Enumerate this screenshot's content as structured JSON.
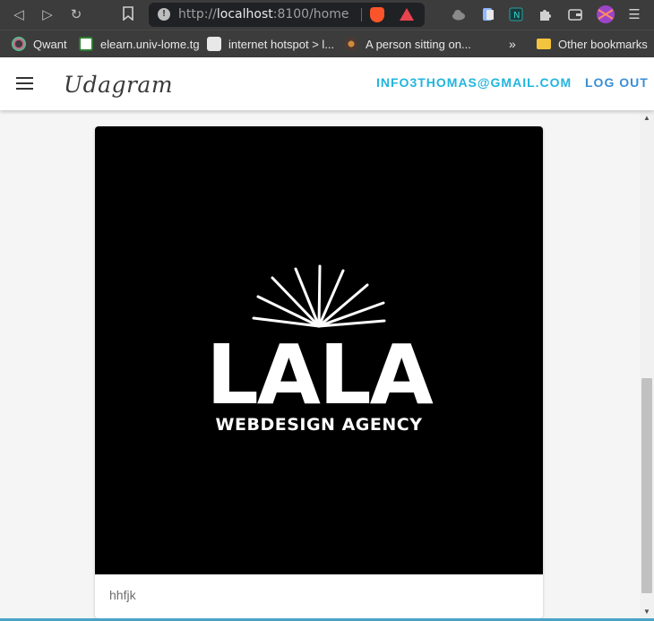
{
  "browser": {
    "url_scheme": "http://",
    "url_host": "localhost",
    "url_rest": ":8100/home",
    "bookmarks": [
      {
        "label": "Qwant",
        "color": "#3ecf8e"
      },
      {
        "label": "elearn.univ-lome.tg",
        "color": "#2e7d32"
      },
      {
        "label": "internet hotspot > l...",
        "color": "#cfcfcf"
      },
      {
        "label": "A person sitting on...",
        "color": "#8d6e63"
      }
    ],
    "overflow": "»",
    "other_bookmarks": "Other bookmarks"
  },
  "app": {
    "brand": "Udagram",
    "user_email": "INFO3THOMAS@GMAIL.COM",
    "logout_label": "LOG OUT",
    "accent_email": "#21b5dd",
    "accent_logout": "#3a8ed6"
  },
  "feed": {
    "items": [
      {
        "image_logo_main": "LALA",
        "image_logo_sub": "WEBDESIGN AGENCY",
        "caption": "hhfjk"
      }
    ]
  }
}
